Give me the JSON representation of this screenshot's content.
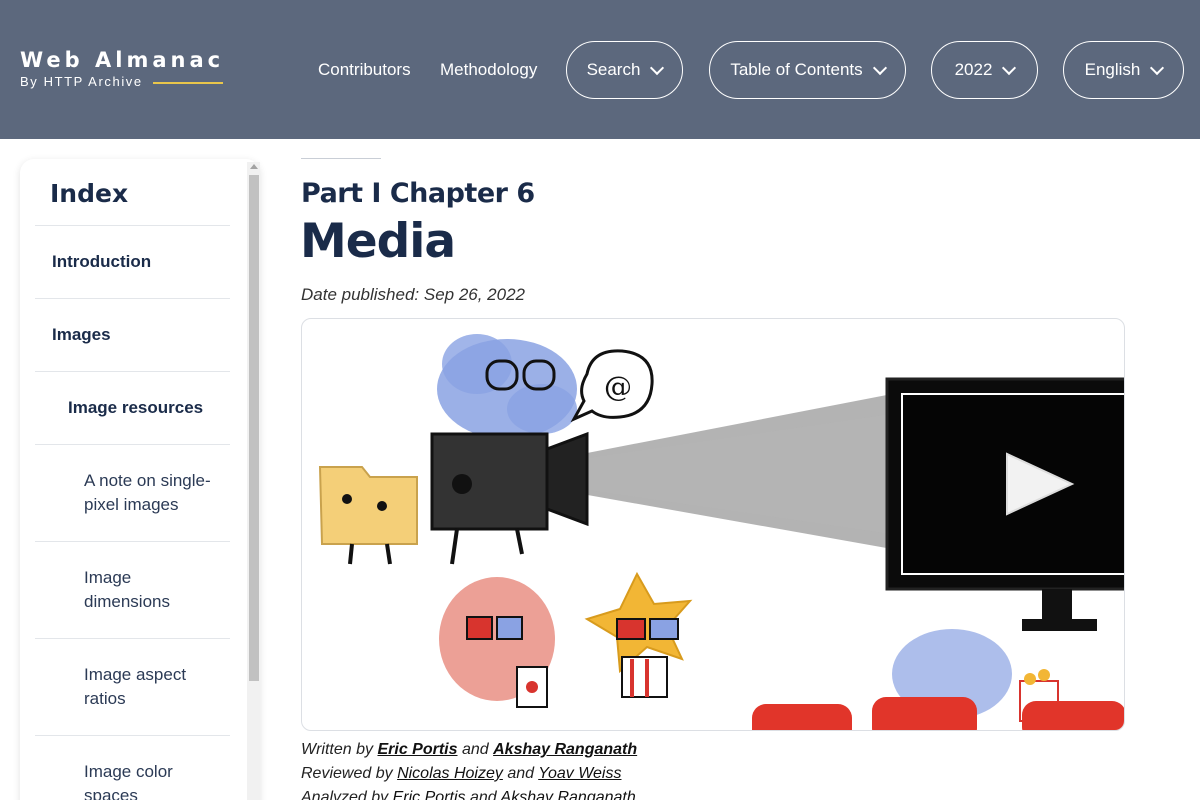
{
  "brand": {
    "title": "Web Almanac",
    "subtitle": "By HTTP Archive"
  },
  "nav": {
    "links": [
      "Contributors",
      "Methodology"
    ],
    "search": "Search",
    "toc": "Table of Contents",
    "year": "2022",
    "language": "English"
  },
  "sidebar": {
    "title": "Index",
    "items": [
      {
        "label": "Introduction"
      },
      {
        "label": "Images"
      },
      {
        "label": "Image resources"
      },
      {
        "label": "A note on single-pixel images"
      },
      {
        "label": "Image dimensions"
      },
      {
        "label": "Image aspect ratios"
      },
      {
        "label": "Image color spaces"
      }
    ]
  },
  "article": {
    "part": "Part I Chapter 6",
    "title": "Media",
    "date": "Date published: Sep 26, 2022",
    "written_label": "Written by",
    "author1": "Eric Portis",
    "and": "and",
    "author2": "Akshay Ranganath",
    "reviewed_label": "Reviewed by",
    "reviewer1": "Nicolas Hoizey",
    "reviewer2": "Yoav Weiss",
    "analyzed_label": "Analyzed by",
    "analyst1": "Eric Portis",
    "analyst2": "Akshay Ranganath"
  },
  "colors": {
    "header_bg": "#5c687d",
    "accent": "#e9c64b",
    "text": "#1a2b49"
  }
}
